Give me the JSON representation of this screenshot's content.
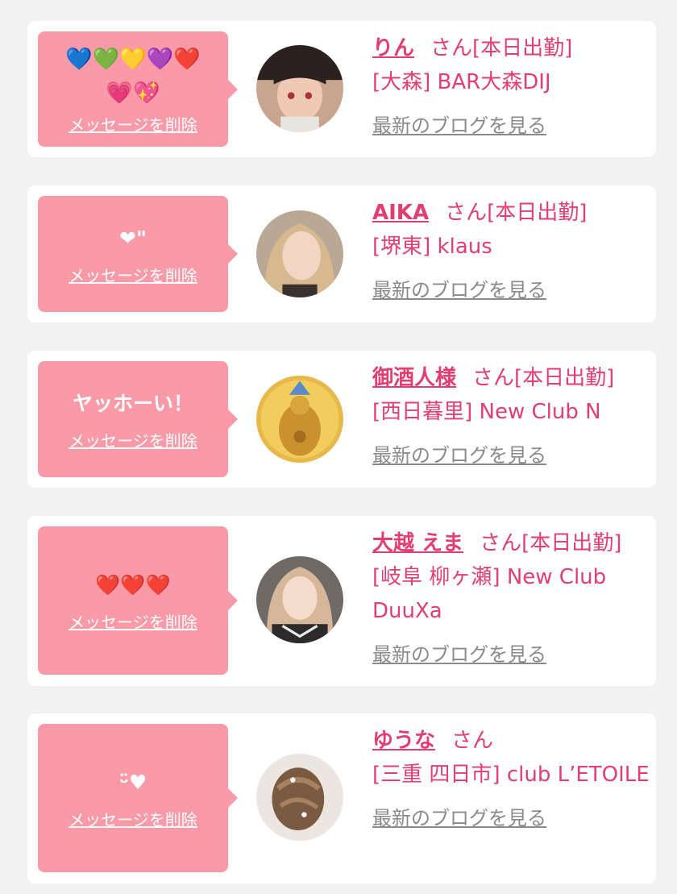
{
  "items": [
    {
      "message": "💙💚💛💜❤️💗💖",
      "delete_label": "メッセージを削除",
      "name": "りん",
      "honorific": "さん",
      "status": "[本日出勤]",
      "location": "[大森] BAR大森DIJ",
      "blog_link": "最新のブログを見る",
      "avatar_icon": "profile-photo"
    },
    {
      "message": "❤\"",
      "delete_label": "メッセージを削除",
      "name": "AIKA",
      "honorific": "さん",
      "status": "[本日出勤]",
      "location": "[堺東] klaus",
      "blog_link": "最新のブログを見る",
      "avatar_icon": "profile-photo"
    },
    {
      "message": "ヤッホーい！",
      "delete_label": "メッセージを削除",
      "name": "御酒人様",
      "honorific": "さん",
      "status": "[本日出勤]",
      "location": "[西日暮里] New Club N",
      "blog_link": "最新のブログを見る",
      "avatar_icon": "golden-statue-photo"
    },
    {
      "message": "❤️❤️❤️",
      "delete_label": "メッセージを削除",
      "name": "大越 えま",
      "honorific": "さん",
      "status": "[本日出勤]",
      "location": "[岐阜 柳ヶ瀬] New Club DuuXa",
      "blog_link": "最新のブログを見る",
      "avatar_icon": "profile-photo"
    },
    {
      "message": "ᵕ̈♥",
      "delete_label": "メッセージを削除",
      "name": "ゆうな",
      "honorific": "さん",
      "status": "",
      "location": "[三重 四日市] club L’ETOILE",
      "blog_link": "最新のブログを見る",
      "avatar_icon": "hairstyle-photo"
    }
  ],
  "colors": {
    "background": "#f2f2f2",
    "bubble": "#fa9aa8",
    "accent": "#e23e71",
    "link_gray": "#8a8a8a"
  }
}
